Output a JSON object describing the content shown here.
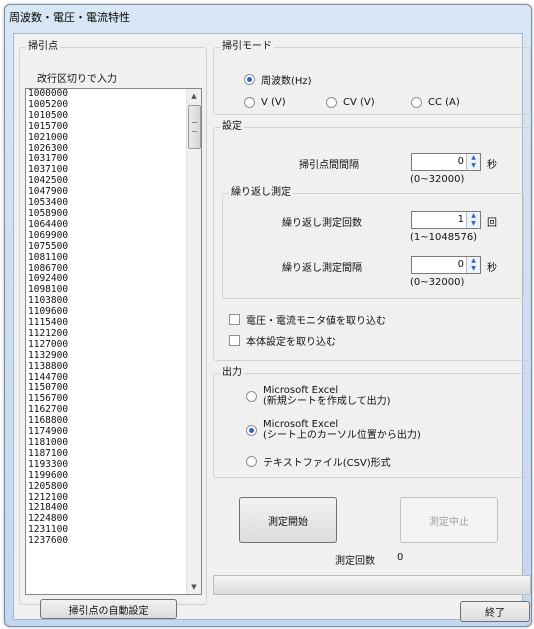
{
  "window": {
    "title": "周波数・電圧・電流特性"
  },
  "sweep_points": {
    "group_label": "掃引点",
    "hint": "改行区切りで入力",
    "values": [
      "1000000",
      "1005200",
      "1010500",
      "1015700",
      "1021000",
      "1026300",
      "1031700",
      "1037100",
      "1042500",
      "1047900",
      "1053400",
      "1058900",
      "1064400",
      "1069900",
      "1075500",
      "1081100",
      "1086700",
      "1092400",
      "1098100",
      "1103800",
      "1109600",
      "1115400",
      "1121200",
      "1127000",
      "1132900",
      "1138800",
      "1144700",
      "1150700",
      "1156700",
      "1162700",
      "1168800",
      "1174900",
      "1181000",
      "1187100",
      "1193300",
      "1199600",
      "1205800",
      "1212100",
      "1218400",
      "1224800",
      "1231100",
      "1237600"
    ],
    "auto_button": "掃引点の自動設定"
  },
  "sweep_mode": {
    "group_label": "掃引モード",
    "options": [
      "周波数(Hz)",
      "V (V)",
      "CV (V)",
      "CC (A)"
    ],
    "selected": "周波数(Hz)"
  },
  "settings": {
    "group_label": "設定",
    "interval_label": "掃引点間間隔",
    "interval_value": "0",
    "interval_unit": "秒",
    "interval_range": "(0~32000)",
    "repeat": {
      "group_label": "繰り返し測定",
      "count_label": "繰り返し測定回数",
      "count_value": "1",
      "count_unit": "回",
      "count_range": "(1~1048576)",
      "interval_label": "繰り返し測定間隔",
      "interval_value": "0",
      "interval_unit": "秒",
      "interval_range": "(0~32000)"
    },
    "check_monitor": "電圧・電流モニタ値を取り込む",
    "check_device": "本体設定を取り込む"
  },
  "output": {
    "group_label": "出力",
    "option1_line1": "Microsoft Excel",
    "option1_line2": "(新規シートを作成して出力)",
    "option2_line1": "Microsoft Excel",
    "option2_line2": "(シート上のカーソル位置から出力)",
    "option3": "テキストファイル(CSV)形式",
    "selected": 2
  },
  "actions": {
    "start": "測定開始",
    "stop": "測定中止",
    "count_label": "測定回数",
    "count_value": "0",
    "close": "終了"
  },
  "progress": {
    "fraction": 0
  },
  "colors": {
    "accent": "#2a63c9"
  }
}
